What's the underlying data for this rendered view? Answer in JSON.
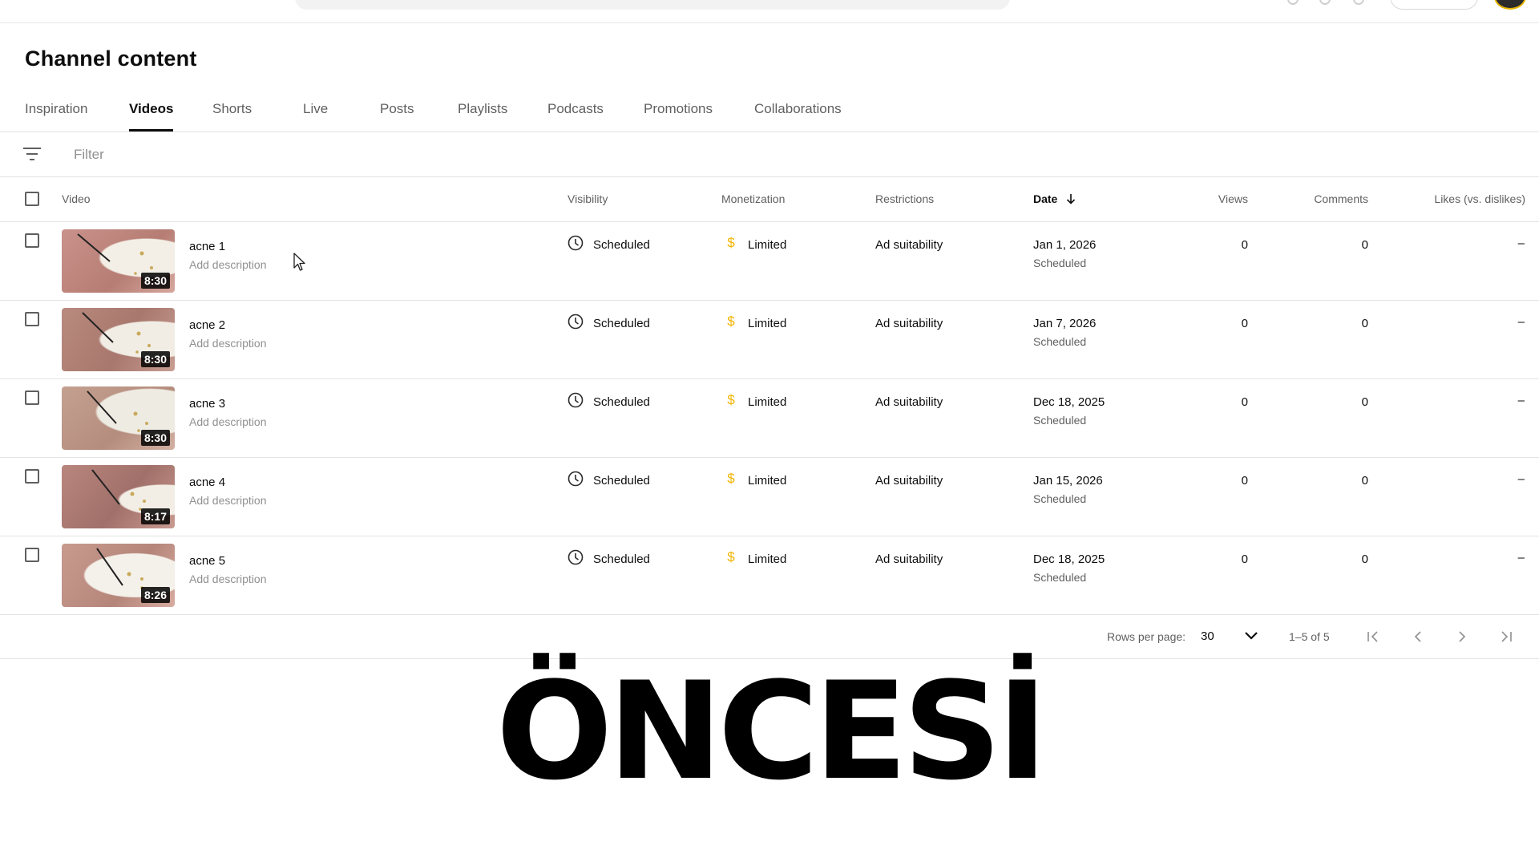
{
  "header": {
    "title": "Channel content"
  },
  "tabs": [
    {
      "label": "Inspiration"
    },
    {
      "label": "Videos",
      "active": true
    },
    {
      "label": "Shorts"
    },
    {
      "label": "Live"
    },
    {
      "label": "Posts"
    },
    {
      "label": "Playlists"
    },
    {
      "label": "Podcasts"
    },
    {
      "label": "Promotions"
    },
    {
      "label": "Collaborations"
    }
  ],
  "filter": {
    "placeholder": "Filter",
    "icon": "filter-list-icon"
  },
  "table": {
    "columns": {
      "video": "Video",
      "visibility": "Visibility",
      "monetization": "Monetization",
      "restrictions": "Restrictions",
      "date": "Date",
      "views": "Views",
      "comments": "Comments",
      "likes": "Likes (vs. dislikes)"
    },
    "sort": {
      "column": "date",
      "direction": "descending",
      "icon": "arrow-down-icon"
    },
    "rows": [
      {
        "title": "acne 1",
        "description": "Add description",
        "duration": "8:30",
        "visibility": "Scheduled",
        "monetization": "Limited",
        "restrictions": "Ad suitability",
        "date": "Jan 1, 2026",
        "date_status": "Scheduled",
        "views": "0",
        "comments": "0",
        "likes": "–"
      },
      {
        "title": "acne 2",
        "description": "Add description",
        "duration": "8:30",
        "visibility": "Scheduled",
        "monetization": "Limited",
        "restrictions": "Ad suitability",
        "date": "Jan 7, 2026",
        "date_status": "Scheduled",
        "views": "0",
        "comments": "0",
        "likes": "–"
      },
      {
        "title": "acne 3",
        "description": "Add description",
        "duration": "8:30",
        "visibility": "Scheduled",
        "monetization": "Limited",
        "restrictions": "Ad suitability",
        "date": "Dec 18, 2025",
        "date_status": "Scheduled",
        "views": "0",
        "comments": "0",
        "likes": "–"
      },
      {
        "title": "acne 4",
        "description": "Add description",
        "duration": "8:17",
        "visibility": "Scheduled",
        "monetization": "Limited",
        "restrictions": "Ad suitability",
        "date": "Jan 15, 2026",
        "date_status": "Scheduled",
        "views": "0",
        "comments": "0",
        "likes": "–"
      },
      {
        "title": "acne 5",
        "description": "Add description",
        "duration": "8:26",
        "visibility": "Scheduled",
        "monetization": "Limited",
        "restrictions": "Ad suitability",
        "date": "Dec 18, 2025",
        "date_status": "Scheduled",
        "views": "0",
        "comments": "0",
        "likes": "–"
      }
    ]
  },
  "pagination": {
    "rows_per_page_label": "Rows per page:",
    "rows_per_page": "30",
    "range": "1–5 of 5"
  },
  "overlay": {
    "caption": "ÖNCESİ"
  },
  "colors": {
    "monetization_limited": "#f2b400",
    "active_tab_underline": "#0d0d0d",
    "divider": "#e3e3e3"
  }
}
